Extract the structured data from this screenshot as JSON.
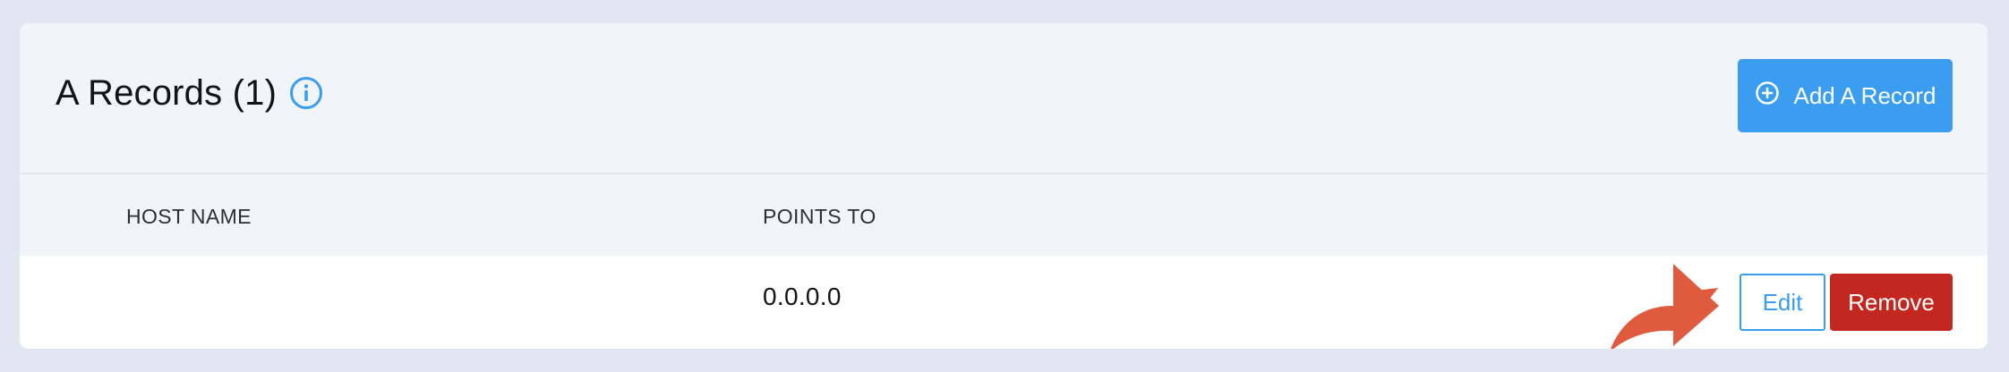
{
  "section": {
    "title": "A Records (1)",
    "info_icon": "info-icon",
    "add_button": {
      "label": "Add A Record",
      "icon": "plus-circle-icon"
    }
  },
  "table": {
    "columns": [
      "HOST NAME",
      "POINTS TO"
    ],
    "rows": [
      {
        "host_name": "",
        "points_to": "0.0.0.0",
        "actions": {
          "edit_label": "Edit",
          "remove_label": "Remove"
        }
      }
    ]
  },
  "annotation": {
    "icon": "curved-arrow-icon",
    "color": "#e05a3d"
  },
  "colors": {
    "accent": "#3b9df0",
    "danger": "#c2281f",
    "background": "#e1e7f0",
    "card": "#f1f4f9"
  }
}
